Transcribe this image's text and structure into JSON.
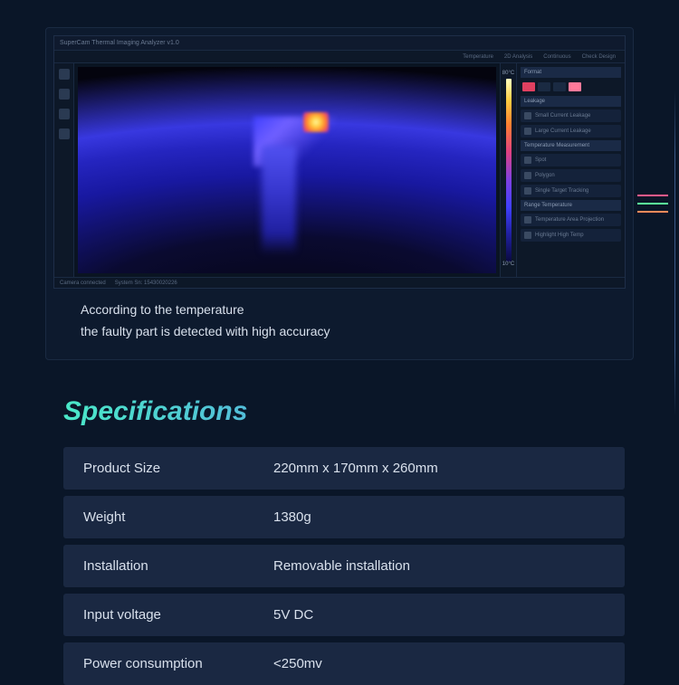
{
  "app": {
    "title": "SuperCam Thermal Imaging Analyzer v1.0",
    "menu": [
      "Temperature",
      "2D Analysis",
      "Continuous",
      "Check Design"
    ],
    "scale_top": "80°C",
    "scale_bottom": "10°C",
    "status_left": "Camera connected",
    "status_right": "System Sn: 15430020226",
    "panels": {
      "format": "Format",
      "leakage": "Leakage",
      "leak1": "Small Current Leakage",
      "leak2": "Large Current Leakage",
      "temp_measure": "Temperature Measurement",
      "spot": "Spot",
      "polygon": "Polygon",
      "single_target": "Single Target Tracking",
      "range_temp": "Range Temperature",
      "temp_area": "Temperature Area Projection",
      "highlight": "Highlight High Temp"
    }
  },
  "caption": {
    "line1": "According to the temperature",
    "line2": "the faulty part is detected with high accuracy"
  },
  "decor_colors": [
    "#ff5a8a",
    "#5aff9a",
    "#ff8a5a"
  ],
  "specs": {
    "title": "Specifications",
    "rows": [
      {
        "label": "Product Size",
        "value": "220mm x 170mm x 260mm"
      },
      {
        "label": "Weight",
        "value": "1380g"
      },
      {
        "label": "Installation",
        "value": "Removable installation"
      },
      {
        "label": "Input voltage",
        "value": "5V DC"
      },
      {
        "label": "Power consumption",
        "value": "<250mv"
      }
    ]
  }
}
